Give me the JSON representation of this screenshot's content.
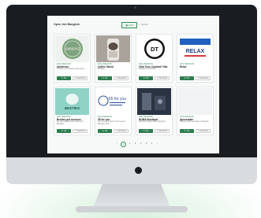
{
  "page": {
    "title": "Open Job Bangkok",
    "view_label": "Grid",
    "search_placeholder": "Search"
  },
  "cards": [
    {
      "category": "ADS, BANGKOK",
      "name": "Ambience",
      "desc": "Contact us and book a table today",
      "thumb_text": "AMBIENCE",
      "phone_label": "Tel",
      "fb_label": "Facebook"
    },
    {
      "category": "ADS, BANGKOK",
      "name": "Coffee Stand",
      "desc": "Bangkok",
      "thumb_text": "",
      "phone_label": "Tel",
      "fb_label": "Facebook"
    },
    {
      "category": "ADS, BANGKOK",
      "name": "Villa Tech, Dumbell Villa",
      "desc": "Bangkok, Nong Chok",
      "thumb_text": "DT",
      "phone_label": "Tel",
      "fb_label": "Facebook"
    },
    {
      "category": "ADS, BANGKOK",
      "name": "Relax",
      "desc": "",
      "thumb_text": "RELAX",
      "phone_label": "Tel",
      "fb_label": "Facebook"
    },
    {
      "category": "ADS, BANGKOK",
      "name": "Besties pet services",
      "desc": "Pet care grooming and training in Bangkok",
      "thumb_text": "BESTIES",
      "phone_label": "Tel",
      "fb_label": "Facebook"
    },
    {
      "category": "ADS, BANGKOK",
      "name": "55 for you",
      "desc": "Your one stop shop for all needs in Bangkok area",
      "thumb_text": "55 for you",
      "phone_label": "Tel",
      "fb_label": "Facebook"
    },
    {
      "category": "ADS, BANGKOK",
      "name": "NOMA Boutique",
      "desc": "Fashion boutique store, Bangkok",
      "thumb_text": "",
      "phone_label": "Tel",
      "fb_label": "Facebook"
    },
    {
      "category": "ADS, BANGKOK",
      "name": "Apexestate",
      "desc": "Property and real estate in Bangkok",
      "thumb_text": "",
      "phone_label": "Tel",
      "fb_label": "Facebook"
    }
  ],
  "pagination": {
    "prev": "‹",
    "pages": [
      "1",
      "2",
      "3",
      "4",
      "5",
      "6"
    ],
    "next": "›",
    "current": "1"
  },
  "colors": {
    "accent": "#2e7d4f",
    "frame": "#1a1d20",
    "chin": "#d9dcde"
  }
}
